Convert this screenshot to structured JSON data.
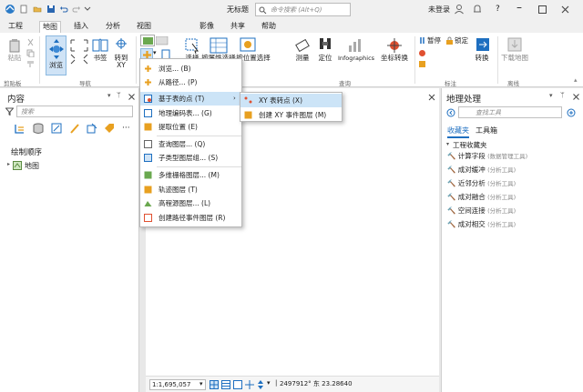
{
  "title": {
    "doc": "无标题",
    "search_placeholder": "命令搜索 (Alt+Q)",
    "user": "未登录",
    "help": "?"
  },
  "tabs": [
    "工程",
    "地图",
    "插入",
    "分析",
    "视图",
    "影像",
    "共享",
    "帮助"
  ],
  "ribbon": {
    "paste": "粘贴",
    "explore": "浏览",
    "bookmarks": "书签",
    "goto_xy": "转到\nXY",
    "select": "选择",
    "select_attr": "按属性选择",
    "select_loc": "按位置选择",
    "measure": "测量",
    "locate": "定位",
    "infographics": "Infographics",
    "coord_convert": "坐标转换",
    "pause": "暂停",
    "lock": "锁定",
    "convert": "转换",
    "download_map": "下载地图",
    "groups": {
      "clipboard": "剪贴板",
      "navigate": "导航",
      "query": "查询",
      "labeling": "标注",
      "offline": "离线"
    }
  },
  "contents": {
    "title": "内容",
    "search_placeholder": "搜索",
    "draw_order": "绘制顺序",
    "map_item": "地图"
  },
  "menu1": [
    "浏览...",
    "从路径...",
    "基于表的点",
    "地理编码表...",
    "提取位置",
    "查询图层...",
    "子类型图层组...",
    "多维栅格图层...",
    "轨迹图层",
    "高程源图层...",
    "创建路径事件图层"
  ],
  "menu1_keys": [
    "(B)",
    "(P)",
    "(T)",
    "(G)",
    "(E)",
    "(Q)",
    "(S)",
    "(M)",
    "(T)",
    "(L)",
    "(R)"
  ],
  "menu2": [
    "XY 表转点",
    "创建 XY 事件图层"
  ],
  "menu2_keys": [
    "(X)",
    "(M)"
  ],
  "gp": {
    "title": "地理处理",
    "search_placeholder": "查找工具",
    "tab_fav": "收藏夹",
    "tab_box": "工具箱",
    "group": "工程收藏夹",
    "items": [
      {
        "name": "计算字段",
        "sub": "(数据管理工具)"
      },
      {
        "name": "成对缓冲",
        "sub": "(分析工具)"
      },
      {
        "name": "近邻分析",
        "sub": "(分析工具)"
      },
      {
        "name": "成对融合",
        "sub": "(分析工具)"
      },
      {
        "name": "空间连接",
        "sub": "(分析工具)"
      },
      {
        "name": "成对相交",
        "sub": "(分析工具)"
      }
    ]
  },
  "status": {
    "scale": "1:1,695,057",
    "coords": "2497912° 东 23.28640"
  },
  "colors": {
    "accent": "#1e6fc0",
    "highlight": "#cce4f7",
    "tab_active": "#ffffff"
  }
}
